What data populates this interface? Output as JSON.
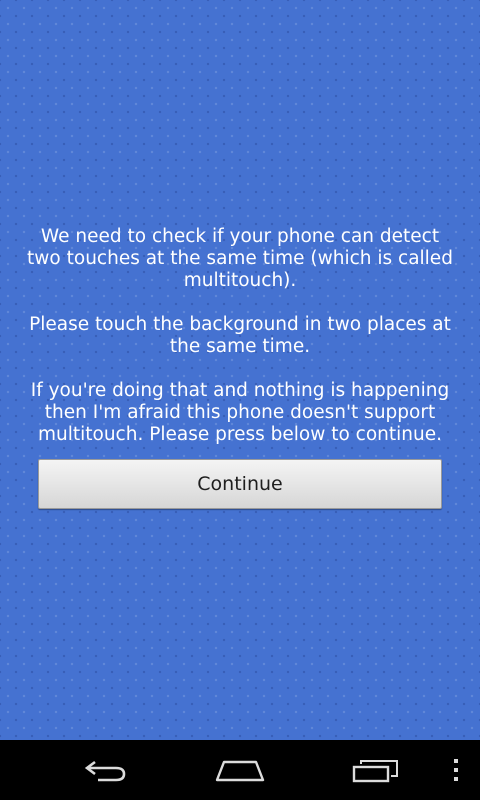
{
  "screen": {
    "background_color": "#4572d1",
    "message": {
      "paragraph1": "We need to check if your phone can detect two touches at the same time (which is called multitouch).",
      "paragraph2": "Please touch the background in two places at the same time.",
      "paragraph3": "If you're doing that and nothing is happening then I'm afraid this phone doesn't support multitouch. Please press below to continue."
    },
    "continue_label": "Continue"
  },
  "navbar": {
    "icons": [
      "back-icon",
      "home-icon",
      "recent-apps-icon",
      "overflow-menu-icon"
    ]
  }
}
